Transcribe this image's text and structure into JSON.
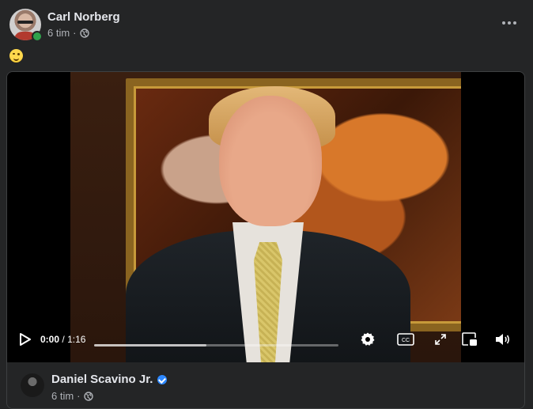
{
  "post": {
    "author": "Carl Norberg",
    "time": "6 tim",
    "separator": "·",
    "privacy_icon": "globe-icon",
    "emoji": "winking-face"
  },
  "video": {
    "current_time": "0:00",
    "duration_separator": "/",
    "duration": "1:16",
    "progress_fraction": 0,
    "buffered_fraction": 0.46,
    "icons": [
      "play-icon",
      "settings-icon",
      "captions-icon",
      "fullscreen-icon",
      "picture-in-picture-icon",
      "volume-icon"
    ]
  },
  "shared_source": {
    "name": "Daniel Scavino Jr.",
    "verified": true,
    "time": "6 tim",
    "separator": "·",
    "privacy_icon": "globe-icon"
  },
  "colors": {
    "background": "#242526",
    "text_primary": "#e4e6eb",
    "text_secondary": "#b0b3b8",
    "online": "#31a24c",
    "verified": "#2d88ff"
  }
}
